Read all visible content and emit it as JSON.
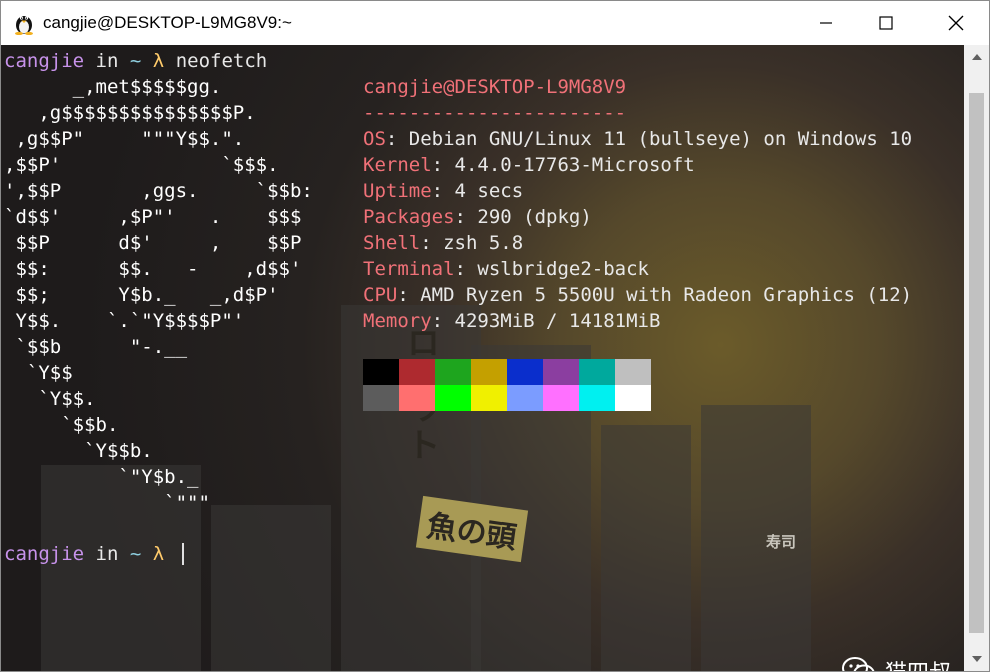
{
  "window": {
    "title": "cangjie@DESKTOP-L9MG8V9:~"
  },
  "prompt1": {
    "user": "cangjie",
    "in": "in",
    "tilde": "~",
    "lambda": "λ",
    "cmd": "neofetch"
  },
  "art": [
    "      _,met$$$$$gg.",
    "   ,g$$$$$$$$$$$$$$$P.",
    " ,g$$P\"     \"\"\"Y$$.\".",
    ",$$P'              `$$$.",
    "',$$P       ,ggs.     `$$b:",
    "`d$$'     ,$P\"'   .    $$$",
    " $$P      d$'     ,    $$P",
    " $$:      $$.   -    ,d$$'",
    " $$;      Y$b._   _,d$P'",
    " Y$$.    `.`\"Y$$$$P\"'",
    " `$$b      \"-.__",
    "  `Y$$",
    "   `Y$$.",
    "     `$$b.",
    "       `Y$$b.",
    "          `\"Y$b._",
    "              `\"\"\""
  ],
  "info": {
    "header": "cangjie@DESKTOP-L9MG8V9",
    "separator": "-----------------------",
    "rows": [
      {
        "label": "OS",
        "value": "Debian GNU/Linux 11 (bullseye) on Windows 10"
      },
      {
        "label": "Kernel",
        "value": "4.4.0-17763-Microsoft"
      },
      {
        "label": "Uptime",
        "value": "4 secs"
      },
      {
        "label": "Packages",
        "value": "290 (dpkg)"
      },
      {
        "label": "Shell",
        "value": "zsh 5.8"
      },
      {
        "label": "Terminal",
        "value": "wslbridge2-back"
      },
      {
        "label": "CPU",
        "value": "AMD Ryzen 5 5500U with Radeon Graphics (12)"
      },
      {
        "label": "Memory",
        "value": "4293MiB / 14181MiB"
      }
    ]
  },
  "palette": {
    "normal": [
      "#000000",
      "#ae2a2f",
      "#1ea51e",
      "#c4a000",
      "#0a2ecc",
      "#8b3ea0",
      "#00a99d",
      "#bfbfbf"
    ],
    "bright": [
      "#5c5c5c",
      "#ff6f6f",
      "#00ff00",
      "#f0f000",
      "#7b9cff",
      "#ff70ff",
      "#00f0f0",
      "#ffffff"
    ]
  },
  "prompt2": {
    "user": "cangjie",
    "in": "in",
    "tilde": "~",
    "lambda": "λ"
  },
  "background": {
    "sign1": "ロボット",
    "sign2": "魚の頭",
    "sign3": "寿司"
  },
  "watermark": {
    "text": "猫四叔"
  }
}
